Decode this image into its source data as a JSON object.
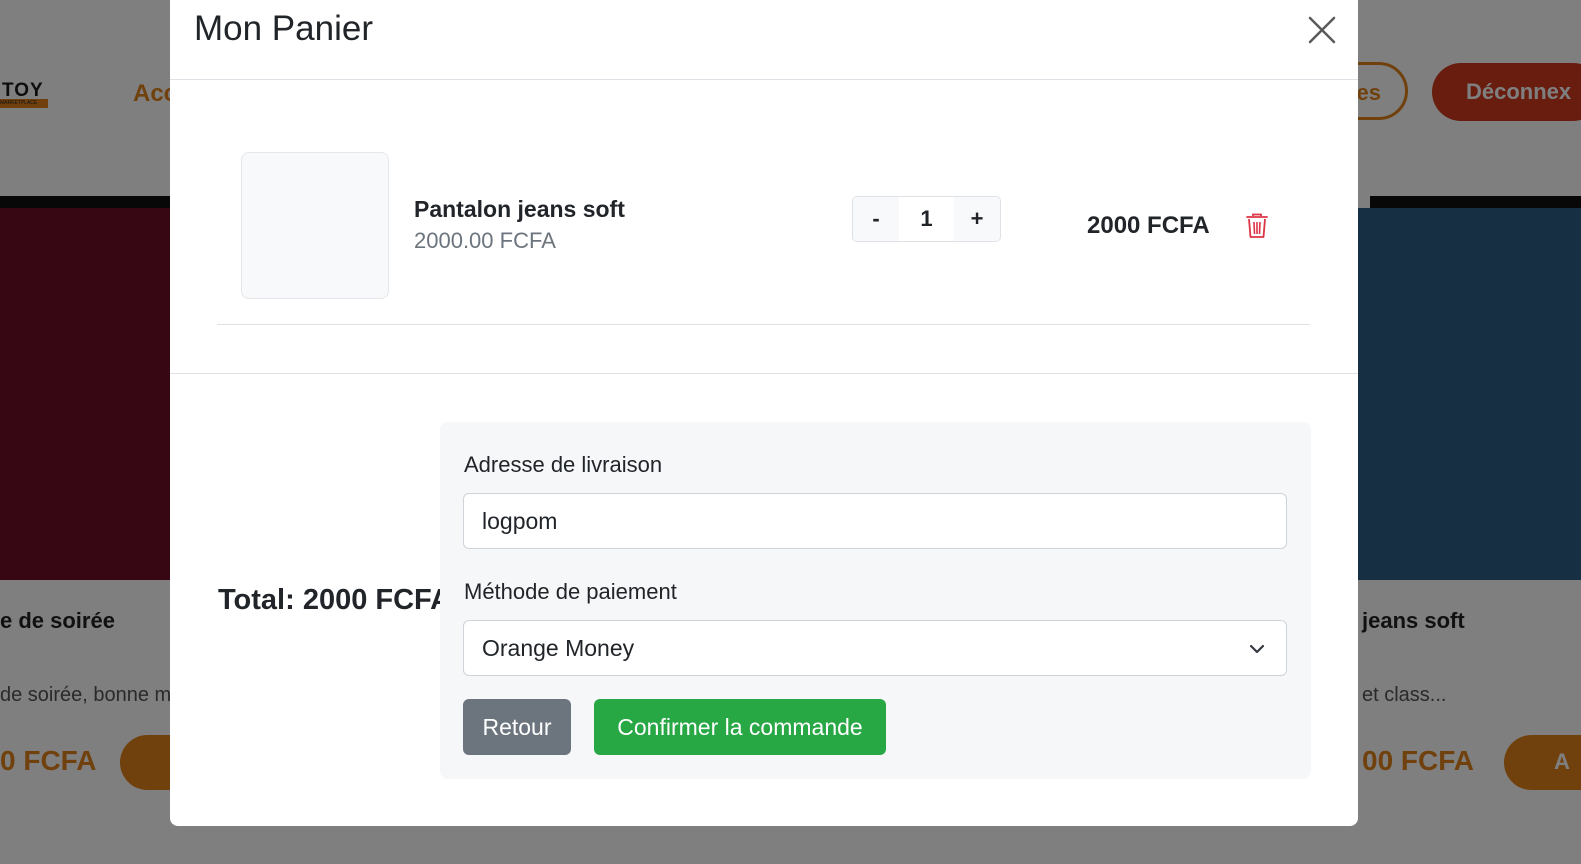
{
  "background": {
    "logo_text": "TOY",
    "logo_subtext": "MARKETPLACE",
    "nav_link": "Acc",
    "nav_outline_button": "es",
    "nav_logout_button": "Déconnex",
    "product_left": {
      "title": "e de soirée",
      "desc": "de soirée, bonne m",
      "price": "0 FCFA"
    },
    "product_right": {
      "title": "jeans soft",
      "desc": "et class...",
      "price": "00 FCFA",
      "cart_label": "A"
    }
  },
  "modal": {
    "title": "Mon Panier",
    "item": {
      "name": "Pantalon jeans soft",
      "unit_price": "2000.00 FCFA",
      "quantity": "1",
      "minus_label": "-",
      "plus_label": "+",
      "line_total": "2000 FCFA"
    },
    "total": "Total: 2000 FCFA",
    "form": {
      "address_label": "Adresse de livraison",
      "address_value": "logpom",
      "payment_label": "Méthode de paiement",
      "payment_value": "Orange Money",
      "back_button": "Retour",
      "confirm_button": "Confirmer la commande"
    }
  },
  "colors": {
    "accent": "#e0821a",
    "danger": "#dc3545",
    "success": "#28a745",
    "secondary": "#6c757d"
  }
}
